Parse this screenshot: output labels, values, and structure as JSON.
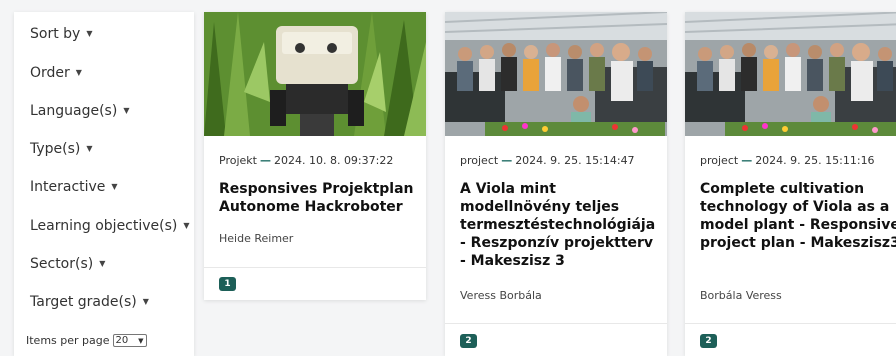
{
  "filters": {
    "sort_by": "Sort by",
    "order": "Order",
    "language": "Language(s)",
    "type": "Type(s)",
    "interactive": "Interactive",
    "learning_objective": "Learning objective(s)",
    "sector": "Sector(s)",
    "target_grade": "Target grade(s)"
  },
  "items_per_page": {
    "label": "Items per page",
    "value": "20"
  },
  "accent_color": "#1d5f58",
  "cards": [
    {
      "type": "Projekt",
      "date": "2024. 10. 8. 09:37:22",
      "title": "Responsives Projektplan Autonome Hackroboter",
      "author": "Heide Reimer",
      "badge": "1",
      "image": "robot-in-cornfield-photo"
    },
    {
      "type": "project",
      "date": "2024. 9. 25. 15:14:47",
      "title": "A Viola mint modellnövény teljes termesztéstechnológiája - Reszponzív projektterv - Makeszisz 3",
      "author": "Veress Borbála",
      "badge": "2",
      "image": "greenhouse-group-photo"
    },
    {
      "type": "project",
      "date": "2024. 9. 25. 15:11:16",
      "title": "Complete cultivation technology of Viola as a model plant - Responsive project plan - Makeszisz3",
      "author": "Borbála Veress",
      "badge": "2",
      "image": "greenhouse-group-photo"
    }
  ]
}
